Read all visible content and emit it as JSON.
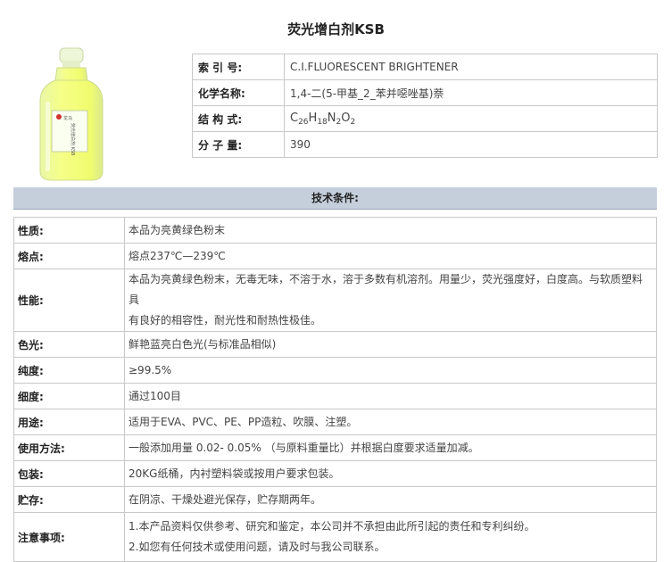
{
  "title": "荧光增白剂KSB",
  "product": {
    "label_brand": "龙马",
    "label_text": "荧光增白剂 KSB"
  },
  "info": [
    {
      "key": "索 引 号:",
      "value": "C.I.FLUORESCENT BRIGHTENER"
    },
    {
      "key": "化学名称:",
      "value": "1,4-二(5-甲基_2_苯并噁唑基)萘"
    },
    {
      "key": "结 构 式:",
      "formula": {
        "c": "C",
        "c_n": "26",
        "h": "H",
        "h_n": "18",
        "n": "N",
        "n_n": "2",
        "o": "O",
        "o_n": "2"
      }
    },
    {
      "key": "分 子 量:",
      "value": "390"
    }
  ],
  "section_title": "技术条件:",
  "specs": [
    {
      "key": "性质:",
      "lines": [
        "本品为亮黄绿色粉末"
      ]
    },
    {
      "key": "熔点:",
      "lines": [
        "熔点237℃—239℃"
      ]
    },
    {
      "key": "性能:",
      "lines": [
        "本品为亮黄绿色粉末，无毒无味，不溶于水，溶于多数有机溶剂。用量少，荧光强度好，白度高。与软质塑料具",
        "有良好的相容性，耐光性和耐热性极佳。"
      ]
    },
    {
      "key": "色光:",
      "lines": [
        "鲜艳蓝亮白色光(与标准品相似)"
      ]
    },
    {
      "key": "纯度:",
      "lines": [
        "≥99.5%"
      ]
    },
    {
      "key": "细度:",
      "lines": [
        "通过100目"
      ]
    },
    {
      "key": "用途:",
      "lines": [
        "适用于EVA、PVC、PE、PP造粒、吹膜、注塑。"
      ]
    },
    {
      "key": "使用方法:",
      "lines": [
        "一般添加用量 0.02- 0.05% （与原料重量比）并根据白度要求适量加减。"
      ]
    },
    {
      "key": "包装:",
      "lines": [
        "20KG纸桶，内衬塑料袋或按用户要求包装。"
      ]
    },
    {
      "key": "贮存:",
      "lines": [
        "在阴凉、干燥处避光保存，贮存期两年。"
      ]
    },
    {
      "key": "注意事项:",
      "lines": [
        "1.本产品资料仅供参考、研究和鉴定，本公司并不承担由此所引起的责任和专利纠纷。",
        "2.如您有任何技术或使用问题，请及时与我公司联系。"
      ]
    }
  ]
}
